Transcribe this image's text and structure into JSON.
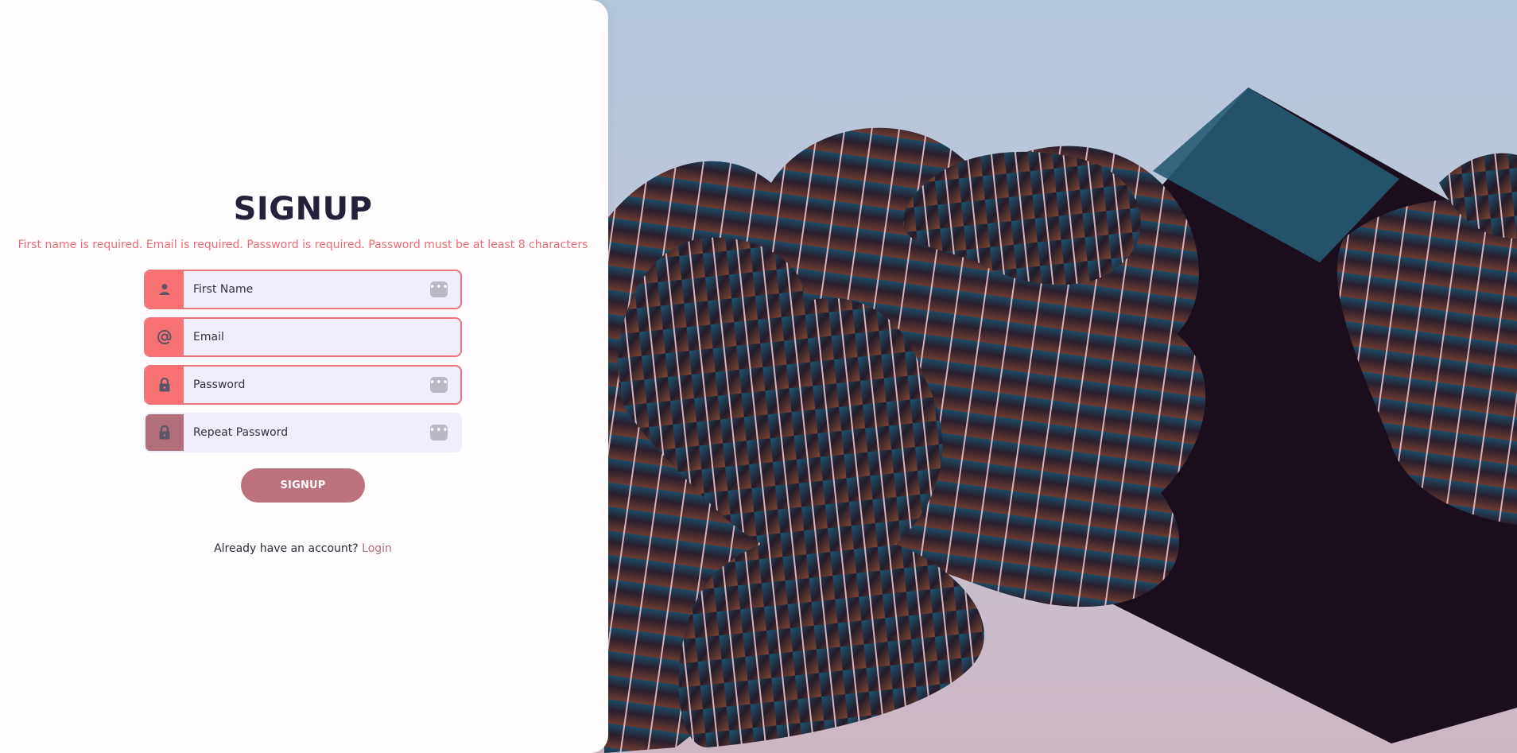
{
  "title": "SIGNUP",
  "errors": "First name is required. Email is required. Password is required. Password must be at least 8 characters",
  "fields": [
    {
      "placeholder": "First Name",
      "icon": "user-icon",
      "error": true,
      "has_dots": true
    },
    {
      "placeholder": "Email",
      "icon": "at-sign-icon",
      "error": true,
      "has_dots": false
    },
    {
      "placeholder": "Password",
      "icon": "lock-icon",
      "error": true,
      "has_dots": true
    },
    {
      "placeholder": "Repeat Password",
      "icon": "lock-icon",
      "error": false,
      "has_dots": true
    }
  ],
  "submit_label": "SIGNUP",
  "footer": {
    "prompt": "Already have an account?",
    "link": "Login"
  },
  "colors": {
    "accent": "#f87274",
    "error_text": "#ea6c74",
    "button": "#bb727d",
    "title": "#26213a",
    "field_bg": "#f1edfc"
  }
}
